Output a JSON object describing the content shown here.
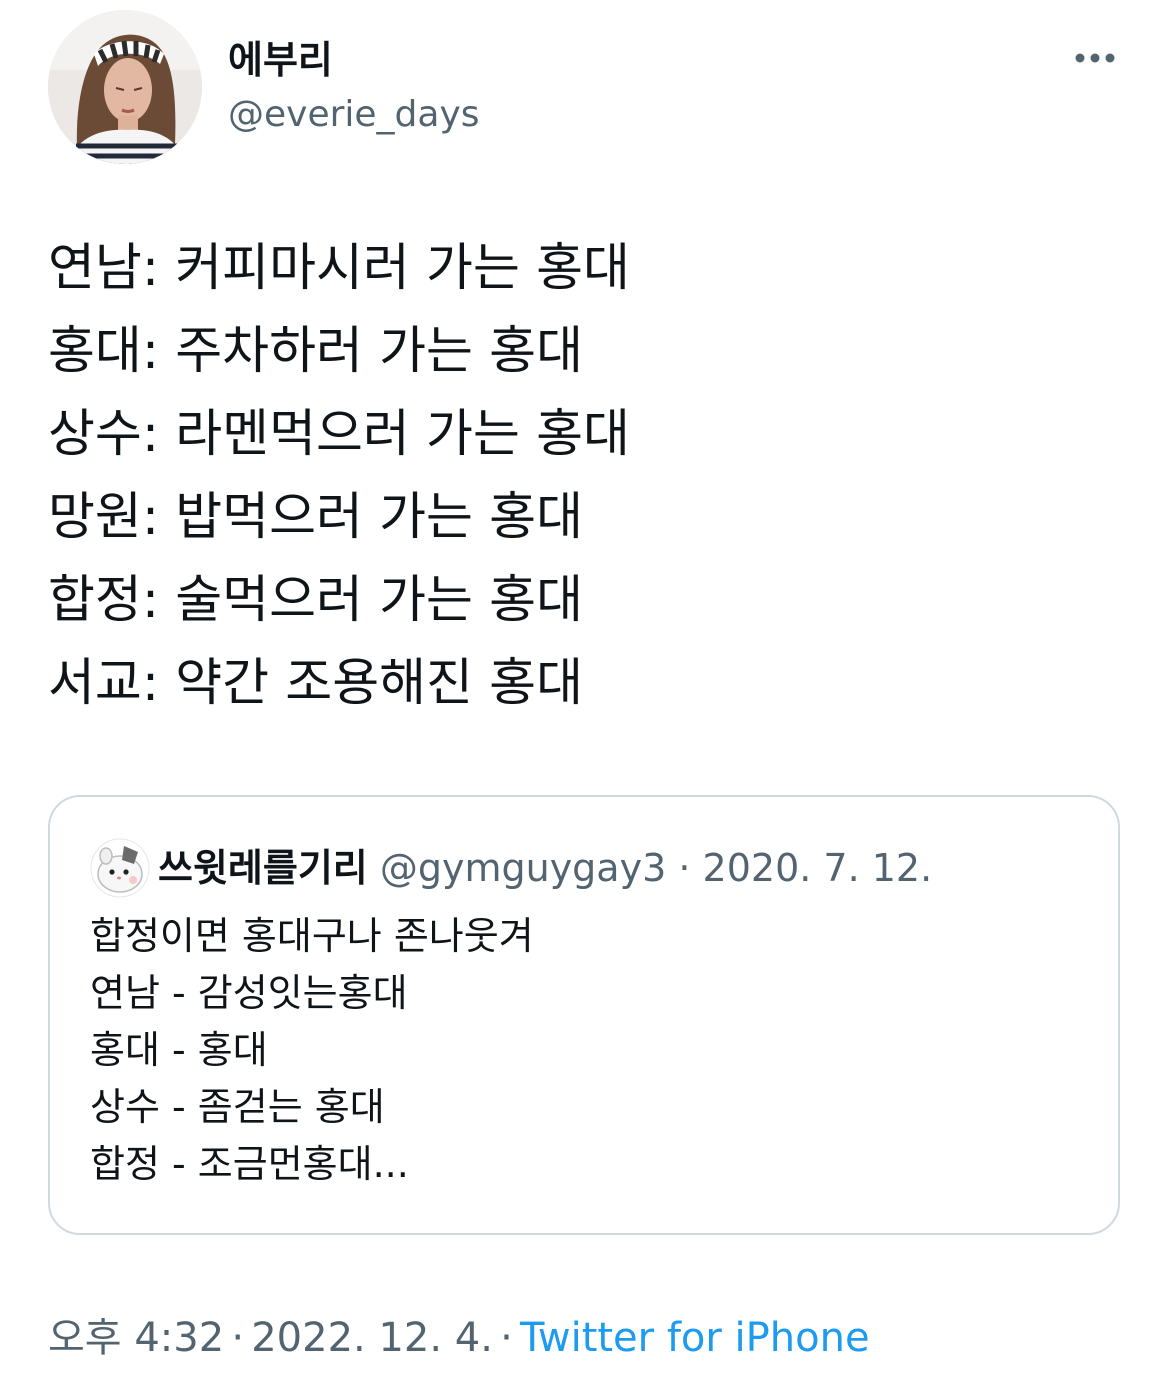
{
  "author": {
    "display_name": "에부리",
    "handle": "@everie_days"
  },
  "menu": {
    "icon": "more-horizontal-icon"
  },
  "tweet": {
    "lines": [
      "연남: 커피마시러 가는 홍대",
      "홍대: 주차하러 가는 홍대",
      "상수: 라멘먹으러 가는 홍대",
      "망원: 밥먹으러 가는 홍대",
      "합정: 술먹으러 가는 홍대",
      "서교: 약간 조용해진 홍대"
    ]
  },
  "quote": {
    "author_name": "쓰윗레를기리",
    "handle": "@gymguygay3",
    "separator": "·",
    "date": "2020. 7. 12.",
    "lines": [
      "합정이면 홍대구나 존나웃겨",
      "연남 - 감성잇는홍대",
      "홍대 - 홍대",
      "상수 - 좀걷는 홍대",
      "합정 - 조금먼홍대..."
    ]
  },
  "footer": {
    "time": "오후 4:32",
    "separator1": "·",
    "date": "2022. 12. 4.",
    "separator2": "·",
    "source": "Twitter for iPhone"
  },
  "colors": {
    "text_primary": "#0f1419",
    "text_secondary": "#536471",
    "link": "#1d9bf0",
    "border": "#cfd9de"
  }
}
